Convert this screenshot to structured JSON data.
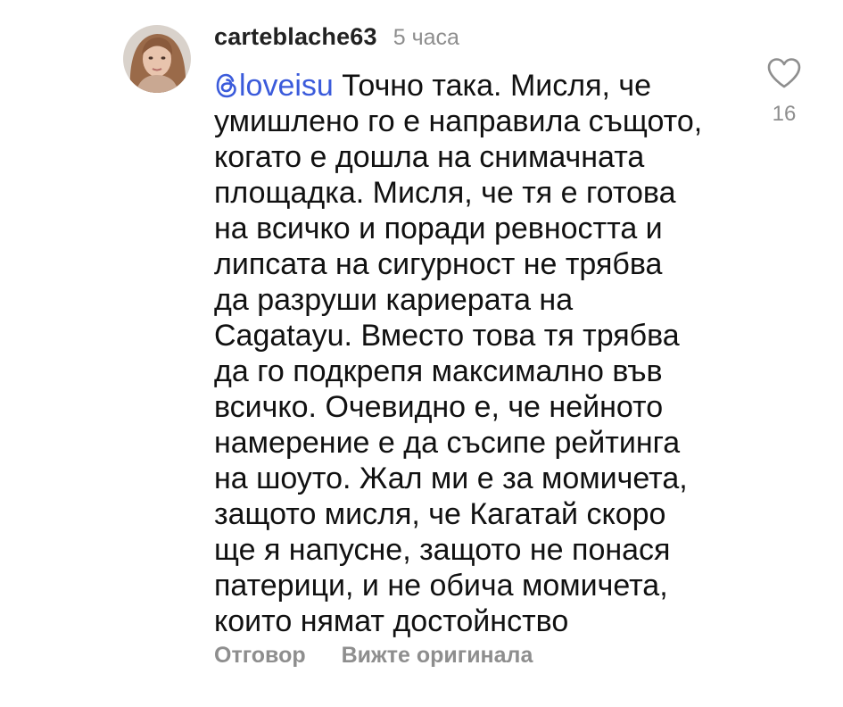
{
  "comment": {
    "avatar_icon": "user-avatar-photo",
    "username": "carteblache63",
    "timestamp": "5 часа",
    "mention": {
      "icon": "threads-icon",
      "handle": "loveisu",
      "color": "#3b5bdb"
    },
    "lines": [
      "Точно така. Мисля, че",
      "умишлено го е направила същото,",
      "когато е дошла на снимачната",
      "площадка. Мисля, че тя е готова",
      "на всичко и поради ревността и",
      "липсата на сигурност не трябва",
      "да разруши кариерата на",
      "Cagatayu. Вместо това тя трябва",
      "да го подкрепя максимално във",
      "всичко. Очевидно е, че нейното",
      "намерение е да съсипе рейтинга",
      "на шоуто. Жал ми е за момичета,",
      "защото мисля, че Кагатай скоро",
      "ще я напусне, защото не понася",
      "патерици, и не обича момичета,",
      "които нямат достойнство"
    ],
    "actions": {
      "reply_label": "Отговор",
      "see_original_label": "Вижте оригинала"
    },
    "like": {
      "icon": "heart-icon",
      "count": "16"
    }
  }
}
